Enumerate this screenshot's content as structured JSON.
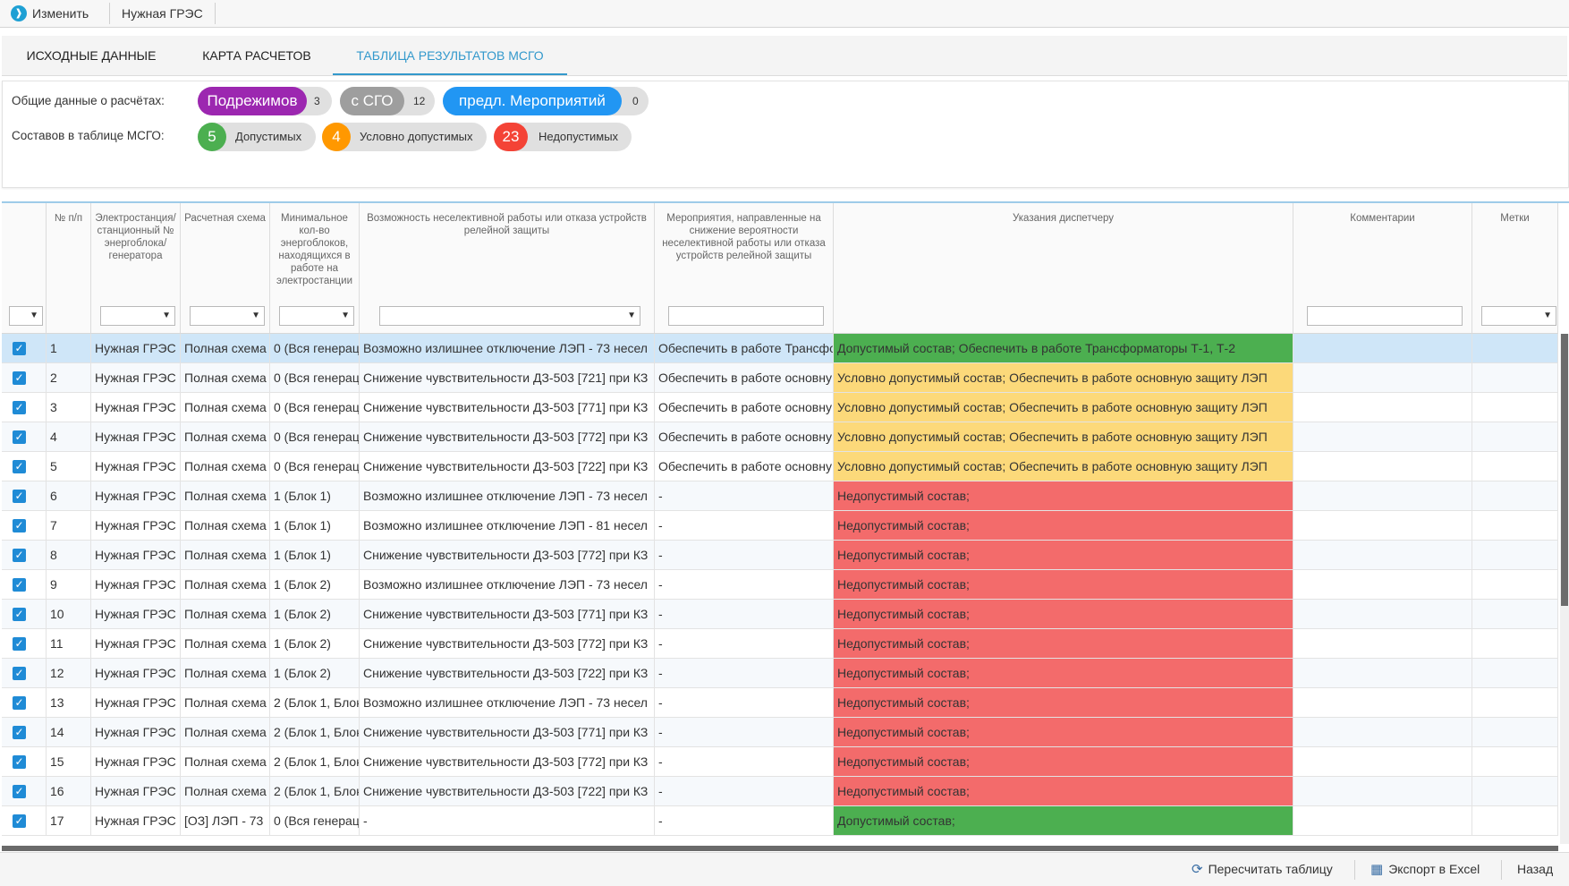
{
  "toolbar": {
    "edit_label": "Изменить",
    "plant_label": "Нужная ГРЭС"
  },
  "tabs": [
    {
      "label": "ИСХОДНЫЕ ДАННЫЕ",
      "active": false
    },
    {
      "label": "КАРТА РАСЧЕТОВ",
      "active": false
    },
    {
      "label": "ТАБЛИЦА РЕЗУЛЬТАТОВ МСГО",
      "active": true
    }
  ],
  "summary": {
    "general_label": "Общие данные о расчётах:",
    "general_pills": [
      {
        "label": "Подрежимов",
        "count": "3",
        "color": "#9c27b0"
      },
      {
        "label": "с СГО",
        "count": "12",
        "color": "#9e9e9e"
      },
      {
        "label": "предл. Мероприятий",
        "count": "0",
        "color": "#2196f3"
      }
    ],
    "composition_label": "Составов в таблице МСГО:",
    "composition_pills": [
      {
        "count": "5",
        "label": "Допустимых",
        "color": "#4caf50"
      },
      {
        "count": "4",
        "label": "Условно допустимых",
        "color": "#ff9800"
      },
      {
        "count": "23",
        "label": "Недопустимых",
        "color": "#f44336"
      }
    ]
  },
  "table": {
    "columns": [
      "",
      "№ п/п",
      "Электростанция/ станционный № энергоблока/ генератора",
      "Расчетная схема",
      "Минимальное кол-во энергоблоков, находящихся в работе на электростанции",
      "Возможность неселективной работы или отказа устройств релейной защиты",
      "Мероприятия, направленные на снижение вероятности неселективной работы или отказа устройств релейной защиты",
      "Указания диспетчеру",
      "Комментарии",
      "Метки"
    ],
    "rows": [
      {
        "n": "1",
        "plant": "Нужная ГРЭС |",
        "scheme": "Полная схема",
        "min": "0 (Вся генерац",
        "possibility": "Возможно излишнее отключение ЛЭП - 73 несел",
        "measures": "Обеспечить в работе Трансфо",
        "instructions": "Допустимый состав; Обеспечить в работе Трансформаторы Т-1, Т-2",
        "status": "green"
      },
      {
        "n": "2",
        "plant": "Нужная ГРЭС |",
        "scheme": "Полная схема",
        "min": "0 (Вся генерац",
        "possibility": "Снижение чувствительности ДЗ-503 [721] при КЗ",
        "measures": "Обеспечить в работе основну",
        "instructions": "Условно допустимый состав; Обеспечить в работе основную защиту ЛЭП",
        "status": "yellow"
      },
      {
        "n": "3",
        "plant": "Нужная ГРЭС |",
        "scheme": "Полная схема",
        "min": "0 (Вся генерац",
        "possibility": "Снижение чувствительности ДЗ-503 [771] при КЗ",
        "measures": "Обеспечить в работе основну",
        "instructions": "Условно допустимый состав; Обеспечить в работе основную защиту ЛЭП",
        "status": "yellow"
      },
      {
        "n": "4",
        "plant": "Нужная ГРЭС |",
        "scheme": "Полная схема",
        "min": "0 (Вся генерац",
        "possibility": "Снижение чувствительности ДЗ-503 [772] при КЗ",
        "measures": "Обеспечить в работе основну",
        "instructions": "Условно допустимый состав; Обеспечить в работе основную защиту ЛЭП",
        "status": "yellow"
      },
      {
        "n": "5",
        "plant": "Нужная ГРЭС |",
        "scheme": "Полная схема",
        "min": "0 (Вся генерац",
        "possibility": "Снижение чувствительности ДЗ-503 [722] при КЗ",
        "measures": "Обеспечить в работе основну",
        "instructions": "Условно допустимый состав; Обеспечить в работе основную защиту ЛЭП",
        "status": "yellow"
      },
      {
        "n": "6",
        "plant": "Нужная ГРЭС |",
        "scheme": "Полная схема",
        "min": "1 (Блок 1)",
        "possibility": "Возможно излишнее отключение ЛЭП - 73 несел",
        "measures": "-",
        "instructions": "Недопустимый состав;",
        "status": "red"
      },
      {
        "n": "7",
        "plant": "Нужная ГРЭС |",
        "scheme": "Полная схема",
        "min": "1 (Блок 1)",
        "possibility": "Возможно излишнее отключение ЛЭП - 81 несел",
        "measures": "-",
        "instructions": "Недопустимый состав;",
        "status": "red"
      },
      {
        "n": "8",
        "plant": "Нужная ГРЭС |",
        "scheme": "Полная схема",
        "min": "1 (Блок 1)",
        "possibility": "Снижение чувствительности ДЗ-503 [772] при КЗ",
        "measures": "-",
        "instructions": "Недопустимый состав;",
        "status": "red"
      },
      {
        "n": "9",
        "plant": "Нужная ГРЭС |",
        "scheme": "Полная схема",
        "min": "1 (Блок 2)",
        "possibility": "Возможно излишнее отключение ЛЭП - 73 несел",
        "measures": "-",
        "instructions": "Недопустимый состав;",
        "status": "red"
      },
      {
        "n": "10",
        "plant": "Нужная ГРЭС |",
        "scheme": "Полная схема",
        "min": "1 (Блок 2)",
        "possibility": "Снижение чувствительности ДЗ-503 [771] при КЗ",
        "measures": "-",
        "instructions": "Недопустимый состав;",
        "status": "red"
      },
      {
        "n": "11",
        "plant": "Нужная ГРЭС |",
        "scheme": "Полная схема",
        "min": "1 (Блок 2)",
        "possibility": "Снижение чувствительности ДЗ-503 [772] при КЗ",
        "measures": "-",
        "instructions": "Недопустимый состав;",
        "status": "red"
      },
      {
        "n": "12",
        "plant": "Нужная ГРЭС |",
        "scheme": "Полная схема",
        "min": "1 (Блок 2)",
        "possibility": "Снижение чувствительности ДЗ-503 [722] при КЗ",
        "measures": "-",
        "instructions": "Недопустимый состав;",
        "status": "red"
      },
      {
        "n": "13",
        "plant": "Нужная ГРЭС |",
        "scheme": "Полная схема",
        "min": "2 (Блок 1, Блок",
        "possibility": "Возможно излишнее отключение ЛЭП - 73 несел",
        "measures": "-",
        "instructions": "Недопустимый состав;",
        "status": "red"
      },
      {
        "n": "14",
        "plant": "Нужная ГРЭС |",
        "scheme": "Полная схема",
        "min": "2 (Блок 1, Блок",
        "possibility": "Снижение чувствительности ДЗ-503 [771] при КЗ",
        "measures": "-",
        "instructions": "Недопустимый состав;",
        "status": "red"
      },
      {
        "n": "15",
        "plant": "Нужная ГРЭС |",
        "scheme": "Полная схема",
        "min": "2 (Блок 1, Блок",
        "possibility": "Снижение чувствительности ДЗ-503 [772] при КЗ",
        "measures": "-",
        "instructions": "Недопустимый состав;",
        "status": "red"
      },
      {
        "n": "16",
        "plant": "Нужная ГРЭС |",
        "scheme": "Полная схема",
        "min": "2 (Блок 1, Блок",
        "possibility": "Снижение чувствительности ДЗ-503 [722] при КЗ",
        "measures": "-",
        "instructions": "Недопустимый состав;",
        "status": "red"
      },
      {
        "n": "17",
        "plant": "Нужная ГРЭС |",
        "scheme": "[ОЗ] ЛЭП - 73",
        "min": "0 (Вся генерац",
        "possibility": "-",
        "measures": "-",
        "instructions": "Допустимый состав;",
        "status": "green"
      }
    ]
  },
  "status_colors": {
    "green": "#4caf50",
    "yellow": "#fcd97a",
    "red": "#f36b6b"
  },
  "footer": {
    "recalc_label": "Пересчитать таблицу",
    "export_label": "Экспорт в Excel",
    "back_label": "Назад"
  }
}
